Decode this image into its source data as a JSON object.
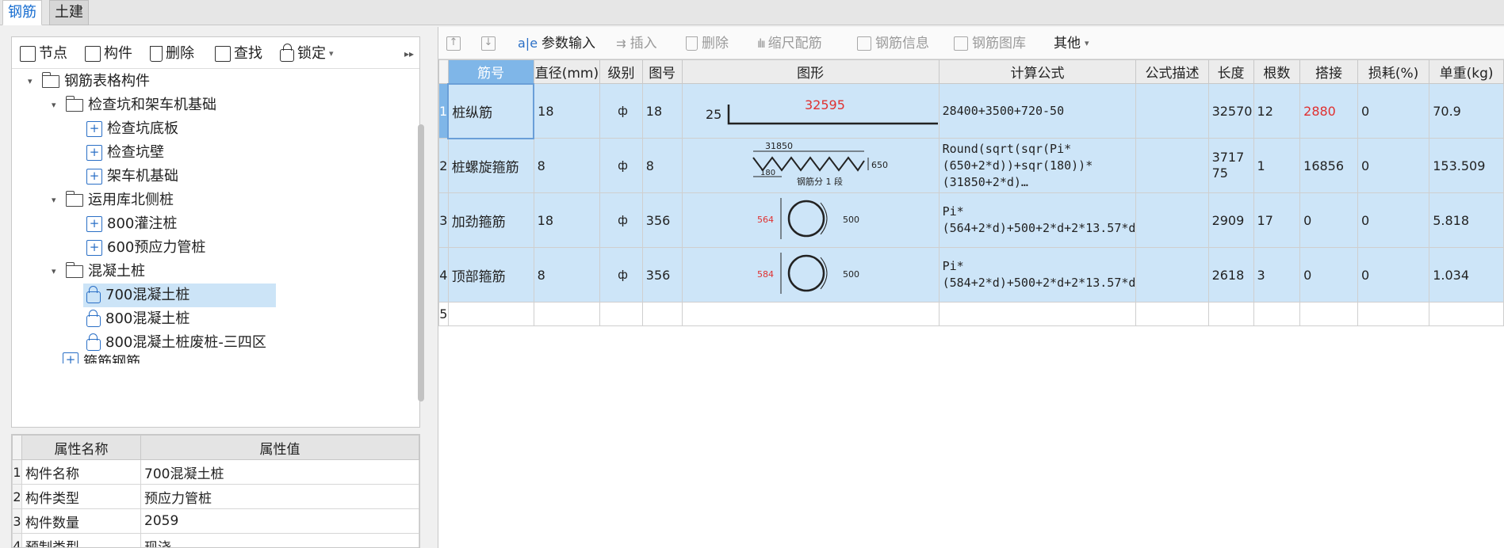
{
  "tabs": [
    {
      "label": "钢筋"
    },
    {
      "label": "土建"
    }
  ],
  "left_toolbar": {
    "node": "节点",
    "component": "构件",
    "delete": "删除",
    "find": "查找",
    "lock": "锁定"
  },
  "tree": {
    "root": "钢筋表格构件",
    "groups": [
      {
        "label": "检查坑和架车机基础",
        "items": [
          "检查坑底板",
          "检查坑壁",
          "架车机基础"
        ]
      },
      {
        "label": "运用库北侧桩",
        "items": [
          "800灌注桩",
          "600预应力管桩"
        ]
      },
      {
        "label": "混凝土桩",
        "items": [
          "700混凝土桩",
          "800混凝土桩",
          "800混凝土桩废桩-三四区"
        ]
      }
    ],
    "partial": "箍筋钢筋"
  },
  "props": {
    "headers": [
      "属性名称",
      "属性值"
    ],
    "rows": [
      {
        "i": "1",
        "name": "构件名称",
        "value": "700混凝土桩"
      },
      {
        "i": "2",
        "name": "构件类型",
        "value": "预应力管桩"
      },
      {
        "i": "3",
        "name": "构件数量",
        "value": "2059"
      },
      {
        "i": "4",
        "name": "预制类型",
        "value": "现浇"
      }
    ]
  },
  "right_toolbar": {
    "param_input": "参数输入",
    "insert": "插入",
    "delete": "删除",
    "scale": "缩尺配筋",
    "info": "钢筋信息",
    "library": "钢筋图库",
    "other": "其他"
  },
  "grid": {
    "headers": [
      "筋号",
      "直径(mm)",
      "级别",
      "图号",
      "图形",
      "计算公式",
      "公式描述",
      "长度",
      "根数",
      "搭接",
      "损耗(%)",
      "单重(kg)"
    ],
    "rows": [
      {
        "i": "1",
        "name": "桩纵筋",
        "dia": "18",
        "grade": "ф",
        "fig": "18",
        "formula": "28400+3500+720-50",
        "desc": "",
        "len": "32570",
        "count": "12",
        "lap": "2880",
        "loss": "0",
        "weight": "70.9",
        "shape": {
          "left": "25",
          "mid": "32595"
        }
      },
      {
        "i": "2",
        "name": "桩螺旋箍筋",
        "dia": "8",
        "grade": "ф",
        "fig": "8",
        "formula": "Round(sqrt(sqr(Pi*(650+2*d))+sqr(180))*(31850+2*d)…",
        "desc": "",
        "len": "371775",
        "count": "1",
        "lap": "16856",
        "loss": "0",
        "weight": "153.509",
        "shape": {
          "top": "31850",
          "right": "650",
          "bottom": "180",
          "note": "钢筋分 1 段"
        }
      },
      {
        "i": "3",
        "name": "加劲箍筋",
        "dia": "18",
        "grade": "ф",
        "fig": "356",
        "formula": "Pi*(564+2*d)+500+2*d+2*13.57*d",
        "desc": "",
        "len": "2909",
        "count": "17",
        "lap": "0",
        "loss": "0",
        "weight": "5.818",
        "shape": {
          "left": "564",
          "right": "500"
        }
      },
      {
        "i": "4",
        "name": "顶部箍筋",
        "dia": "8",
        "grade": "ф",
        "fig": "356",
        "formula": "Pi*(584+2*d)+500+2*d+2*13.57*d",
        "desc": "",
        "len": "2618",
        "count": "3",
        "lap": "0",
        "loss": "0",
        "weight": "1.034",
        "shape": {
          "left": "584",
          "right": "500"
        }
      },
      {
        "i": "5"
      }
    ]
  }
}
